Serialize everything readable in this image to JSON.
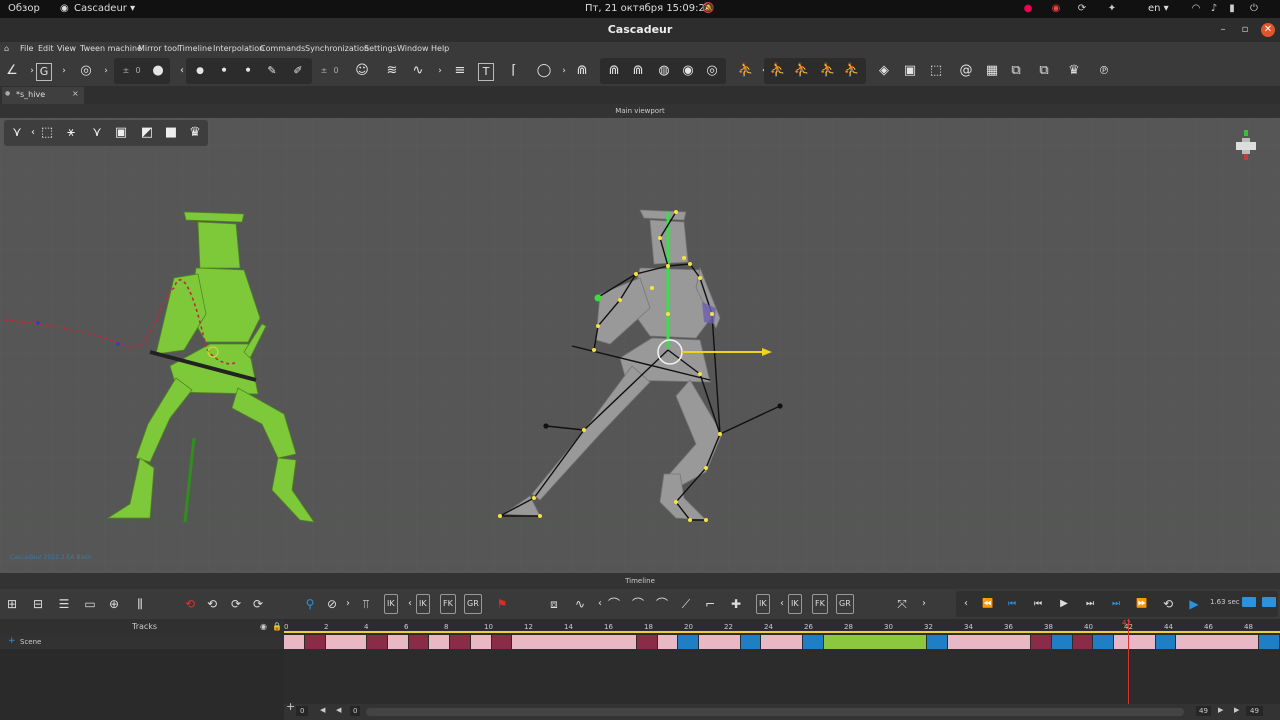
{
  "system_bar": {
    "overview": "Обзор",
    "app_menu": "Cascadeur ▾",
    "clock": "Пт, 21 октября  15:09:29",
    "lang": "en ▾"
  },
  "window": {
    "title": "Cascadeur"
  },
  "menu": [
    "File",
    "Edit",
    "View",
    "Tween machine",
    "Mirror tool",
    "Timeline",
    "Interpolation",
    "Commands",
    "Synchronization",
    "Settings",
    "Window",
    "Help"
  ],
  "toolbar": {
    "field_a": "0",
    "field_b": "0"
  },
  "tab": {
    "label": "*s_hive",
    "close": "×"
  },
  "viewport": {
    "header": "Main viewport",
    "watermark": "Cascadeur 2022.2 EA Basic"
  },
  "timeline": {
    "header": "Timeline",
    "tracks_label": "Tracks",
    "scene_label": "Scene",
    "ik1": "IK",
    "ik2": "IK",
    "fk": "FK",
    "gr": "GR",
    "ik3": "IK",
    "ik4": "IK",
    "fk2": "FK",
    "gr2": "GR",
    "speed": "1.63 sec",
    "ticks": [
      "0",
      "2",
      "4",
      "6",
      "8",
      "10",
      "12",
      "14",
      "16",
      "18",
      "20",
      "22",
      "24",
      "26",
      "28",
      "30",
      "32",
      "34",
      "36",
      "38",
      "40",
      "42",
      "44",
      "46",
      "48"
    ],
    "current_frame": "42",
    "bottom": {
      "start": "0",
      "left_val": "0",
      "right_val": "49",
      "end": "49"
    }
  },
  "colors": {
    "accent_blue": "#1f7fc4",
    "key_pink": "#e8b8c6",
    "key_maroon": "#8a2b4a",
    "key_green": "#8dc63f",
    "character_green": "#7ec93a"
  }
}
